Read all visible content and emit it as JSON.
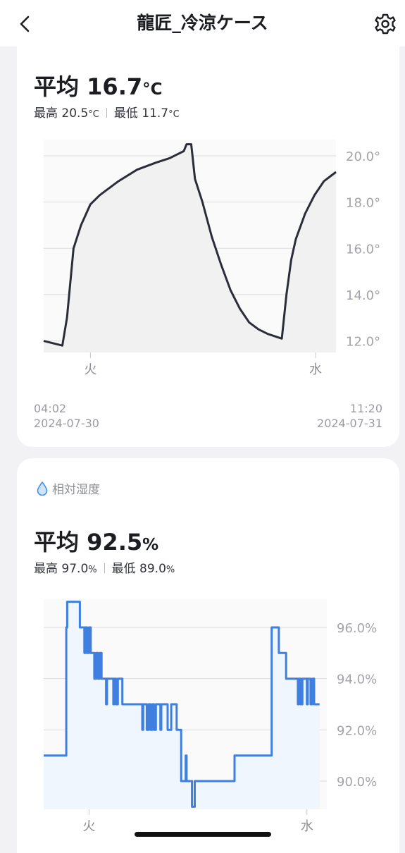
{
  "header": {
    "title": "龍匠_冷涼ケース",
    "back_icon": "chevron-left-icon",
    "settings_icon": "gear-icon"
  },
  "temperature": {
    "avg_label": "平均",
    "avg_value": "16.7",
    "unit": "°C",
    "max_label": "最高",
    "max_value": "20.5",
    "min_label": "最低",
    "min_value": "11.7",
    "start_time": "04:02",
    "start_date": "2024-07-30",
    "end_time": "11:20",
    "end_date": "2024-07-31"
  },
  "humidity": {
    "section_label": "相対湿度",
    "section_icon": "water-drop-icon",
    "avg_label": "平均",
    "avg_value": "92.5",
    "unit": "%",
    "max_label": "最高",
    "max_value": "97.0",
    "min_label": "最低",
    "min_value": "89.0"
  },
  "colors": {
    "temp_line": "#2b2d38",
    "humidity_line": "#3f7fe0",
    "accent": "#3f7fe0"
  },
  "chart_data": [
    {
      "type": "line",
      "title": "",
      "xlabel": "",
      "ylabel": "",
      "x_ticks": [
        "火",
        "水"
      ],
      "y_ticks": [
        "12.0°",
        "14.0°",
        "16.0°",
        "18.0°",
        "20.0°"
      ],
      "ylim": [
        11.5,
        20.7
      ],
      "grid": true,
      "x_unit": "hours since 04:02 2024-07-30",
      "xlim": [
        0,
        31.3
      ],
      "points": [
        [
          0,
          12.0
        ],
        [
          2,
          11.8
        ],
        [
          2.5,
          13.0
        ],
        [
          3.2,
          16.0
        ],
        [
          4,
          17.0
        ],
        [
          5,
          17.9
        ],
        [
          6,
          18.3
        ],
        [
          8,
          18.9
        ],
        [
          10,
          19.4
        ],
        [
          12,
          19.7
        ],
        [
          13.5,
          19.9
        ],
        [
          15,
          20.2
        ],
        [
          15.3,
          20.5
        ],
        [
          15.8,
          20.5
        ],
        [
          16.2,
          19.0
        ],
        [
          17,
          18.0
        ],
        [
          18,
          16.5
        ],
        [
          19,
          15.3
        ],
        [
          20,
          14.2
        ],
        [
          21,
          13.4
        ],
        [
          22,
          12.8
        ],
        [
          23,
          12.5
        ],
        [
          24,
          12.3
        ],
        [
          25.5,
          12.1
        ],
        [
          26,
          14.0
        ],
        [
          26.5,
          15.5
        ],
        [
          27,
          16.4
        ],
        [
          28,
          17.5
        ],
        [
          29,
          18.3
        ],
        [
          30,
          18.9
        ],
        [
          31.3,
          19.3
        ]
      ]
    },
    {
      "type": "line",
      "title": "",
      "xlabel": "",
      "ylabel": "",
      "x_ticks": [
        "火",
        "水"
      ],
      "y_ticks": [
        "90.0%",
        "92.0%",
        "94.0%",
        "96.0%"
      ],
      "ylim": [
        88.9,
        97.1
      ],
      "grid": true,
      "x_unit": "hours since 04:02 2024-07-30",
      "xlim": [
        0,
        31.3
      ],
      "step": true,
      "points": [
        [
          0,
          91
        ],
        [
          2.2,
          91
        ],
        [
          2.5,
          96
        ],
        [
          2.6,
          97
        ],
        [
          3.8,
          97
        ],
        [
          4,
          96
        ],
        [
          4.4,
          96
        ],
        [
          4.5,
          95
        ],
        [
          4.6,
          96
        ],
        [
          4.8,
          95
        ],
        [
          5.0,
          96
        ],
        [
          5.2,
          95
        ],
        [
          5.4,
          95
        ],
        [
          5.6,
          94
        ],
        [
          5.8,
          95
        ],
        [
          6.0,
          94
        ],
        [
          6.2,
          95
        ],
        [
          6.4,
          94
        ],
        [
          6.8,
          94
        ],
        [
          6.9,
          93
        ],
        [
          7.0,
          94
        ],
        [
          7.6,
          94
        ],
        [
          7.7,
          93
        ],
        [
          7.8,
          94
        ],
        [
          8.0,
          93
        ],
        [
          8.2,
          94
        ],
        [
          8.6,
          94
        ],
        [
          8.7,
          93
        ],
        [
          10.8,
          93
        ],
        [
          10.9,
          92
        ],
        [
          11.0,
          93
        ],
        [
          11.3,
          93
        ],
        [
          11.4,
          92
        ],
        [
          11.6,
          93
        ],
        [
          11.8,
          92
        ],
        [
          12.0,
          93
        ],
        [
          12.2,
          92
        ],
        [
          12.4,
          93
        ],
        [
          12.8,
          93
        ],
        [
          12.9,
          92
        ],
        [
          13.0,
          93
        ],
        [
          13.6,
          93
        ],
        [
          13.7,
          92
        ],
        [
          14.0,
          92
        ],
        [
          14.1,
          93
        ],
        [
          14.6,
          93
        ],
        [
          14.7,
          92
        ],
        [
          15.0,
          92
        ],
        [
          15.2,
          90
        ],
        [
          15.6,
          90
        ],
        [
          15.7,
          91
        ],
        [
          15.8,
          90
        ],
        [
          16.2,
          90
        ],
        [
          16.3,
          90
        ],
        [
          16.4,
          89
        ],
        [
          16.6,
          89
        ],
        [
          16.7,
          90
        ],
        [
          21.0,
          90
        ],
        [
          21.1,
          91
        ],
        [
          25.0,
          91
        ],
        [
          25.2,
          96
        ],
        [
          25.9,
          96
        ],
        [
          26.0,
          95
        ],
        [
          26.6,
          95
        ],
        [
          26.8,
          94
        ],
        [
          28.0,
          94
        ],
        [
          28.1,
          93
        ],
        [
          28.2,
          94
        ],
        [
          28.4,
          93
        ],
        [
          28.6,
          94
        ],
        [
          29.0,
          94
        ],
        [
          29.1,
          93
        ],
        [
          29.2,
          94
        ],
        [
          29.4,
          94
        ],
        [
          29.5,
          93
        ],
        [
          29.7,
          94
        ],
        [
          29.9,
          93
        ],
        [
          30.5,
          93
        ]
      ]
    }
  ]
}
